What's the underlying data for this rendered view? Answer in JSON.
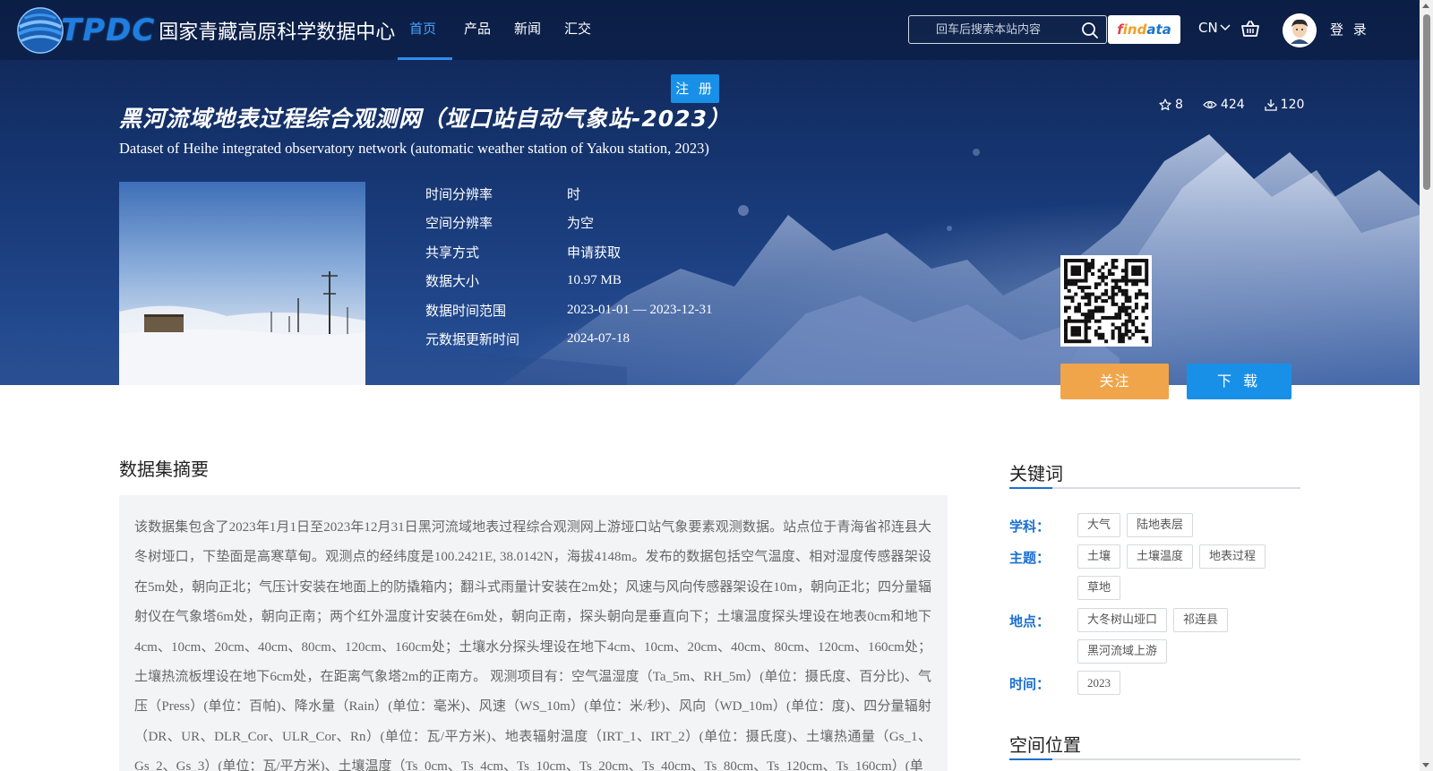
{
  "header": {
    "logo_latin": "TPDC",
    "logo_cn": "国家青藏高原科学数据中心",
    "nav": [
      {
        "label": "首页",
        "active": true
      },
      {
        "label": "产品",
        "active": false
      },
      {
        "label": "新闻",
        "active": false
      },
      {
        "label": "汇交",
        "active": false
      }
    ],
    "search_placeholder": "回车后搜索本站内容",
    "findata": [
      "f",
      "ind",
      "ata"
    ],
    "lang": "CN",
    "login_label": "登 录",
    "register_label": "注 册"
  },
  "dataset": {
    "title_cn": "黑河流域地表过程综合观测网（垭口站自动气象站-2023）",
    "title_en": "Dataset of Heihe integrated observatory network (automatic weather station of Yakou station, 2023)",
    "stats": {
      "stars": "8",
      "views": "424",
      "downloads": "120"
    },
    "meta": [
      {
        "label": "时间分辨率",
        "value": "时"
      },
      {
        "label": "空间分辨率",
        "value": "为空"
      },
      {
        "label": "共享方式",
        "value": "申请获取"
      },
      {
        "label": "数据大小",
        "value": "10.97 MB"
      },
      {
        "label": "数据时间范围",
        "value": "2023-01-01 — 2023-12-31"
      },
      {
        "label": "元数据更新时间",
        "value": "2024-07-18"
      }
    ],
    "follow_label": "关注",
    "download_label": "下 载"
  },
  "abstract": {
    "title": "数据集摘要",
    "text": "该数据集包含了2023年1月1日至2023年12月31日黑河流域地表过程综合观测网上游垭口站气象要素观测数据。站点位于青海省祁连县大冬树垭口，下垫面是高寒草甸。观测点的经纬度是100.2421E, 38.0142N，海拔4148m。发布的数据包括空气温度、相对湿度传感器架设在5m处，朝向正北；气压计安装在地面上的防撬箱内；翻斗式雨量计安装在2m处；风速与风向传感器架设在10m，朝向正北；四分量辐射仪在气象塔6m处，朝向正南；两个红外温度计安装在6m处，朝向正南，探头朝向是垂直向下；土壤温度探头埋设在地表0cm和地下4cm、10cm、20cm、40cm、80cm、120cm、160cm处；土壤水分探头埋设在地下4cm、10cm、20cm、40cm、80cm、120cm、160cm处；土壤热流板埋设在地下6cm处，在距离气象塔2m的正南方。 观测项目有：空气温湿度（Ta_5m、RH_5m）(单位：摄氏度、百分比)、气压（Press）(单位：百帕)、降水量（Rain）(单位：毫米)、风速（WS_10m）(单位：米/秒)、风向（WD_10m）(单位：度)、四分量辐射（DR、UR、DLR_Cor、ULR_Cor、Rn）(单位：瓦/平方米)、地表辐射温度（IRT_1、IRT_2）(单位：摄氏度)、土壤热通量（Gs_1、Gs_2、Gs_3）(单位：瓦/平方米)、土壤温度（Ts_0cm、Ts_4cm、Ts_10cm、Ts_20cm、Ts_40cm、Ts_80cm、Ts_120cm、Ts_160cm）(单"
  },
  "keywords": {
    "title": "关键词",
    "groups": [
      {
        "label": "学科：",
        "tags": [
          "大气",
          "陆地表层"
        ]
      },
      {
        "label": "主题：",
        "tags": [
          "土壤",
          "土壤温度",
          "地表过程",
          "草地"
        ]
      },
      {
        "label": "地点：",
        "tags": [
          "大冬树山垭口",
          "祁连县",
          "黑河流域上游"
        ]
      },
      {
        "label": "时间：",
        "tags": [
          "2023"
        ]
      }
    ]
  },
  "space": {
    "title": "空间位置"
  },
  "colors": {
    "accent": "#1890e8",
    "follow": "#f0a54a",
    "keyword_label": "#1b6fd1",
    "nav_active": "#4aa3ff"
  }
}
